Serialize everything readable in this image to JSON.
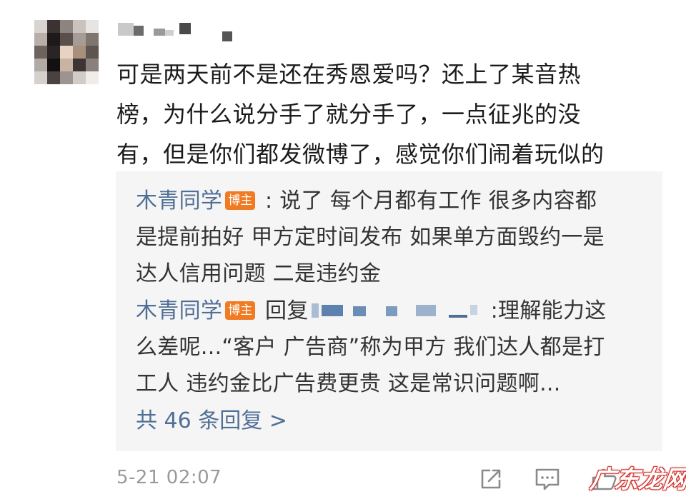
{
  "comment": {
    "lines": [
      "可是两天前不是还在秀恩爱吗？还上了某音热",
      "榜，为什么说分手了就分手了，一点征兆的没",
      "有，但是你们都发微博了，感觉你们闹着玩似的"
    ],
    "timestamp": "5-21 02:07"
  },
  "replies": [
    {
      "author": "木青同学",
      "badge": "博主",
      "separator": " : ",
      "lines": [
        "说了 每个月都有工作 很多内容都",
        "是提前拍好 甲方定时间发布 如果单方面毁约一是",
        "达人信用问题 二是违约金"
      ]
    },
    {
      "author": "木青同学",
      "badge": "博主",
      "verb": " 回复",
      "after_mask": ":理解能力这",
      "lines": [
        "么差呢...“客户 广告商”称为甲方 我们达人都是打",
        "工人 违约金比广告费更贵 这是常识问题啊..."
      ]
    }
  ],
  "more_replies": "共 46 条回复 >",
  "watermark": "广东龙网",
  "icons": {
    "share": "share-icon",
    "comment": "comment-icon",
    "like": "like-icon"
  },
  "colors": {
    "author_link": "#4f6f96",
    "badge": "#f07b22",
    "reply_bg": "#f5f5f5",
    "timestamp": "#9a9a9a"
  }
}
